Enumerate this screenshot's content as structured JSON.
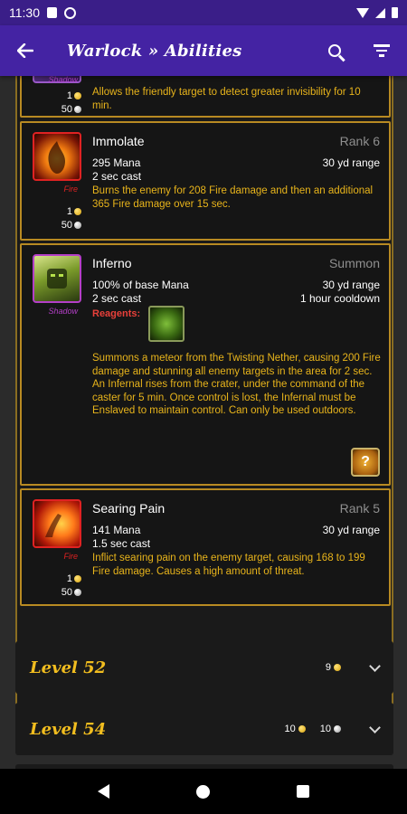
{
  "status": {
    "time": "11:30"
  },
  "appbar": {
    "title": "Warlock » Abilities"
  },
  "spells": [
    {
      "name": "",
      "rank": "",
      "school": "Shadow",
      "school_color": "#b43fc7",
      "cost_gold": "1",
      "cost_silver": "50",
      "desc": "Allows the friendly target to detect greater invisibility for 10 min."
    },
    {
      "name": "Immolate",
      "rank": "Rank 6",
      "school": "Fire",
      "school_color": "#e02222",
      "cost_gold": "1",
      "cost_silver": "50",
      "mana": "295 Mana",
      "range": "30 yd range",
      "cast": "2 sec cast",
      "desc": "Burns the enemy for 208 Fire damage and then an additional 365 Fire damage over 15 sec.",
      "icon": "immolate-icon"
    },
    {
      "name": "Inferno",
      "rank": "Summon",
      "school": "Shadow",
      "school_color": "#b43fc7",
      "mana": "100% of base Mana",
      "range": "30 yd range",
      "cast": "2 sec cast",
      "cooldown": "1 hour cooldown",
      "reagents_label": "Reagents:",
      "desc": "Summons a meteor from the Twisting Nether, causing 200 Fire damage and stunning all enemy targets in the area for 2 sec.  An Infernal rises from the crater, under the command of the caster for 5 min.  Once control is lost, the Infernal must be Enslaved to maintain control.  Can only be used outdoors.",
      "icon": "inferno-icon"
    },
    {
      "name": "Searing Pain",
      "rank": "Rank 5",
      "school": "Fire",
      "school_color": "#e02222",
      "cost_gold": "1",
      "cost_silver": "50",
      "mana": "141 Mana",
      "range": "30 yd range",
      "cast": "1.5 sec cast",
      "desc": "Inflict searing pain on the enemy target, causing 168 to 199 Fire damage.  Causes a high amount of threat.",
      "icon": "searing-pain-icon"
    }
  ],
  "levels": [
    {
      "title": "Level 52",
      "gold": "9",
      "silver": ""
    },
    {
      "title": "Level 54",
      "gold": "10",
      "silver": "10"
    }
  ]
}
